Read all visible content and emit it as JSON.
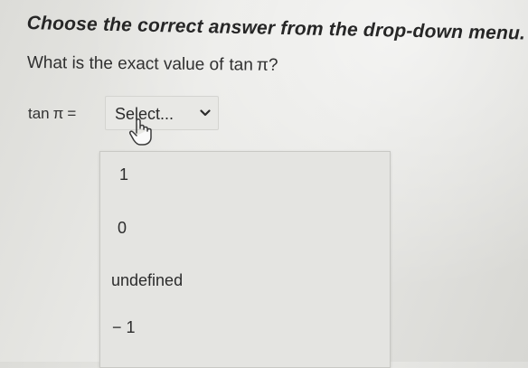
{
  "instruction": "Choose the correct answer from the drop-down menu.",
  "question": {
    "prefix": "What is the exact value of",
    "function": "tan",
    "symbol": "π",
    "suffix": "?"
  },
  "equation": {
    "function": "tan",
    "symbol": "π",
    "equals": "="
  },
  "dropdown": {
    "selected": "Select...",
    "chevron_icon": "chevron-down-icon",
    "options": [
      "1",
      "0",
      "undefined",
      "− 1"
    ]
  },
  "cursor_icon": "hand-pointer-icon"
}
